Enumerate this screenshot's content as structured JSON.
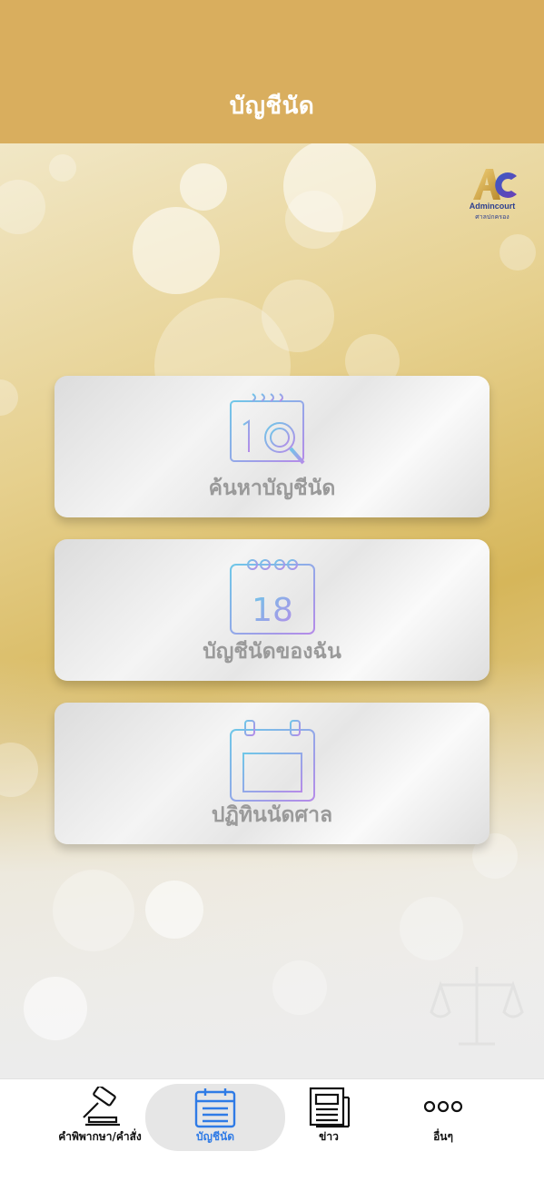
{
  "header": {
    "title": "บัญชีนัด"
  },
  "logo": {
    "name": "Admincourt",
    "subtitle": "ศาลปกครอง"
  },
  "menu": [
    {
      "label": "ค้นหาบัญชีนัด",
      "icon": "calendar-search-icon"
    },
    {
      "label": "บัญชีนัดของฉัน",
      "icon": "calendar-day-icon",
      "day": "18"
    },
    {
      "label": "ปฏิทินนัดศาล",
      "icon": "calendar-grid-icon"
    }
  ],
  "tabs": [
    {
      "label": "คำพิพากษา/คำสั่ง",
      "icon": "gavel-icon"
    },
    {
      "label": "บัญชีนัด",
      "icon": "calendar-icon",
      "active": true
    },
    {
      "label": "ข่าว",
      "icon": "newspaper-icon"
    },
    {
      "label": "อื่นๆ",
      "icon": "more-icon"
    }
  ],
  "colors": {
    "header": "#d9ae5e",
    "active_tab": "#2f7be6",
    "icon_gradient": [
      "#6fc7e8",
      "#b58be8"
    ]
  }
}
